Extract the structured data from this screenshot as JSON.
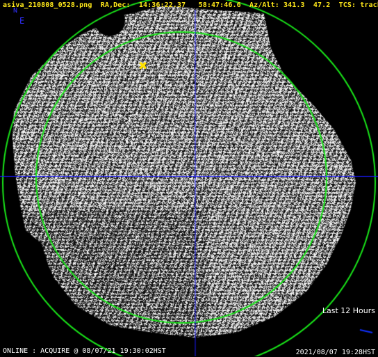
{
  "header": {
    "filename": "asiva_210808_0528.png",
    "radec_label": "RA,Dec:",
    "ra": "14:36:22.37",
    "dec": "58:47:46.6",
    "azalt_label": "Az/Alt:",
    "az": "341.3",
    "alt": "47.2",
    "tcs_label": "TCS:",
    "tcs_value": "track"
  },
  "compass": {
    "north": "N",
    "east": "E"
  },
  "legend": {
    "trail_label": "Last 12 Hours",
    "trail_color": "#1030ff"
  },
  "footer": {
    "status": "ONLINE : ACQUIRE @ 08/07/21 19:30:02HST",
    "timestamp": "2021/08/07 19:28HST"
  },
  "overlay": {
    "target_marker": "✖",
    "target_color": "#ffe100",
    "circle_color": "#19e619",
    "crosshair_color": "#1a1aff"
  }
}
